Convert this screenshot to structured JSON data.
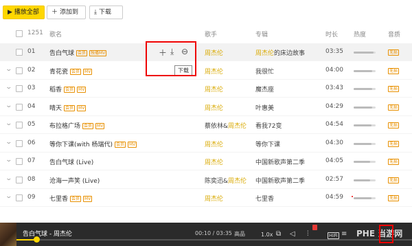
{
  "toolbar": {
    "play_all": "播放全部",
    "add_to": "添加到",
    "download": "下载"
  },
  "table_header": {
    "count": "1251",
    "title": "歌名",
    "artist": "歌手",
    "album": "专辑",
    "duration": "时长",
    "heat": "热度",
    "quality": "音质"
  },
  "rows": [
    {
      "num": "01",
      "title": "告白气球",
      "badges": [
        "会员",
        "独播MV"
      ],
      "artist": "周杰伦",
      "artist_highlight": true,
      "album": "周杰伦的床边故事",
      "album_highlight": true,
      "duration": "03:35",
      "heat": 0.9,
      "quality": "无损"
    },
    {
      "num": "02",
      "title": "青花瓷",
      "badges": [
        "会员",
        "MV"
      ],
      "artist": "周杰伦",
      "artist_highlight": true,
      "album": "我很忙",
      "album_highlight": false,
      "duration": "04:00",
      "heat": 0.85,
      "quality": "无损"
    },
    {
      "num": "03",
      "title": "稻香",
      "badges": [
        "会员",
        "MV"
      ],
      "artist": "周杰伦",
      "artist_highlight": true,
      "album": "魔杰座",
      "album_highlight": false,
      "duration": "03:43",
      "heat": 0.85,
      "quality": "无损"
    },
    {
      "num": "04",
      "title": "晴天",
      "badges": [
        "会员",
        "MV"
      ],
      "artist": "周杰伦",
      "artist_highlight": true,
      "album": "叶惠美",
      "album_highlight": false,
      "duration": "04:29",
      "heat": 0.85,
      "quality": "无损"
    },
    {
      "num": "05",
      "title": "布拉格广场",
      "badges": [
        "会员",
        "MV"
      ],
      "artist_plain": "蔡依林&",
      "artist": "周杰伦",
      "artist_highlight": true,
      "album": "看我72变",
      "album_highlight": false,
      "duration": "04:54",
      "heat": 0.8,
      "quality": "无损"
    },
    {
      "num": "06",
      "title": "等你下课(with 杨瑞代)",
      "badges": [
        "会员",
        "MV"
      ],
      "artist": "周杰伦",
      "artist_highlight": true,
      "album": "等你下课",
      "album_highlight": false,
      "duration": "04:30",
      "heat": 0.8,
      "quality": "无损"
    },
    {
      "num": "07",
      "title": "告白气球 (Live)",
      "badges": [],
      "artist": "周杰伦",
      "artist_highlight": true,
      "album": "中国新歌声第二季",
      "album_highlight": false,
      "duration": "04:05",
      "heat": 0.75,
      "quality": "无损"
    },
    {
      "num": "08",
      "title": "沧海一声笑 (Live)",
      "badges": [],
      "artist_plain": "陈奕迅&",
      "artist": "周杰伦",
      "artist_highlight": true,
      "album": "中国新歌声第二季",
      "album_highlight": false,
      "duration": "02:57",
      "heat": 0.75,
      "quality": "无损"
    },
    {
      "num": "09",
      "title": "七里香",
      "badges": [
        "会员",
        "MV"
      ],
      "artist": "周杰伦",
      "artist_highlight": true,
      "album": "七里香",
      "album_highlight": false,
      "duration": "04:59",
      "heat": 0.8,
      "quality": "无损"
    }
  ],
  "tooltip": "下载",
  "player": {
    "title": "告白气球 - 周杰伦",
    "time": "00:10 / 03:35",
    "quality": "高品",
    "speed": "1.0x",
    "hifi": "HiFi",
    "progress": 0.05
  },
  "watermark": "PHE 当游网",
  "colors": {
    "accent": "#ffd700",
    "highlight": "#d9a900",
    "badge": "#e89000",
    "annotation": "#ee0000"
  }
}
